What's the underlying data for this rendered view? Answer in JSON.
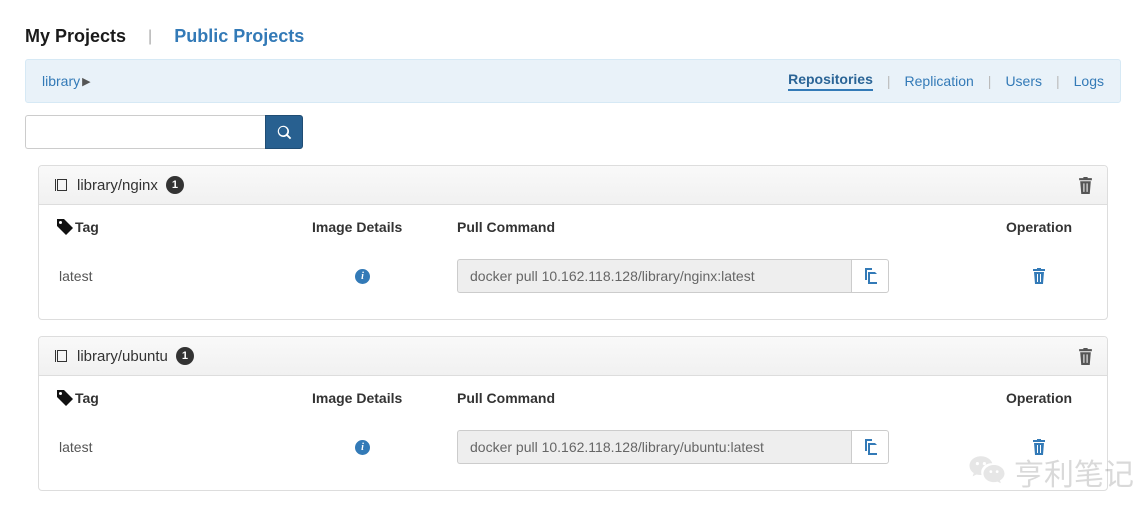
{
  "tabs": {
    "my": "My Projects",
    "public": "Public Projects"
  },
  "breadcrumb": {
    "project": "library"
  },
  "subnav": {
    "repositories": "Repositories",
    "replication": "Replication",
    "users": "Users",
    "logs": "Logs"
  },
  "search": {
    "value": ""
  },
  "headers": {
    "tag": "Tag",
    "details": "Image Details",
    "pull": "Pull Command",
    "op": "Operation"
  },
  "repos": [
    {
      "name": "library/nginx",
      "count": "1",
      "tags": [
        {
          "tag": "latest",
          "pull": "docker pull 10.162.118.128/library/nginx:latest"
        }
      ]
    },
    {
      "name": "library/ubuntu",
      "count": "1",
      "tags": [
        {
          "tag": "latest",
          "pull": "docker pull 10.162.118.128/library/ubuntu:latest"
        }
      ]
    }
  ],
  "watermark": "亨利笔记"
}
